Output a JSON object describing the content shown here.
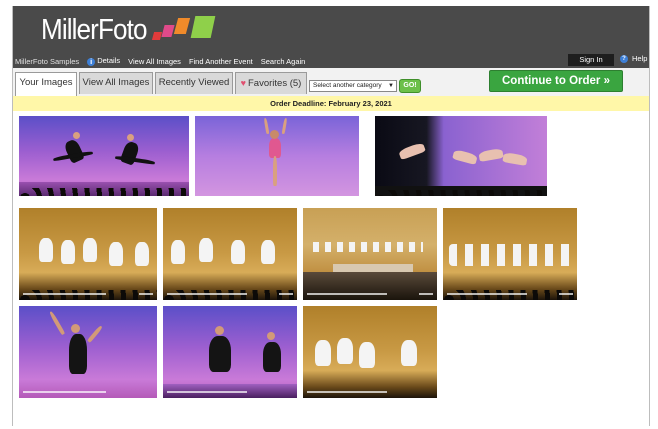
{
  "header": {
    "logo_text": "MillerFoto",
    "logo_colors": [
      "#e03b3b",
      "#f08a2a",
      "#4aa3e0",
      "#8fd04a"
    ],
    "nav": {
      "brand": "MillerFoto Samples",
      "details": "Details",
      "view_all": "View All Images",
      "find_event": "Find Another Event",
      "search_again": "Search Again"
    },
    "sign_in": "Sign In",
    "help": "Help"
  },
  "tabs": [
    {
      "label": "Your Images",
      "active": true
    },
    {
      "label": "View All Images",
      "active": false
    },
    {
      "label": "Recently Viewed",
      "active": false
    },
    {
      "label": "Favorites (5)",
      "active": false
    }
  ],
  "category_select": {
    "value": "Select another category"
  },
  "go_label": "GO!",
  "continue_label": "Continue to Order »",
  "deadline": "Order Deadline: February 23, 2021",
  "colors": {
    "header_bg": "#4a4a4a",
    "order_green": "#3aa540",
    "deadline_yellow": "#fff7a8"
  },
  "photos": [
    {
      "scene": "two dancers in black leaping, purple backdrop"
    },
    {
      "scene": "dancer in pink costume leaping, purple backdrop"
    },
    {
      "scene": "group of dancers leaping, dark stage left"
    },
    {
      "scene": "group of young dancers in white tutus, gold stage"
    },
    {
      "scene": "group of young dancers in white tutus, gold stage"
    },
    {
      "scene": "wide view of dancers on gold stage with audience"
    },
    {
      "scene": "line of young dancers in white, gold stage"
    },
    {
      "scene": "dancer in black costume, purple backdrop"
    },
    {
      "scene": "two dancers in black costumes, purple stage"
    },
    {
      "scene": "young dancers in white tutus, gold stage"
    }
  ]
}
